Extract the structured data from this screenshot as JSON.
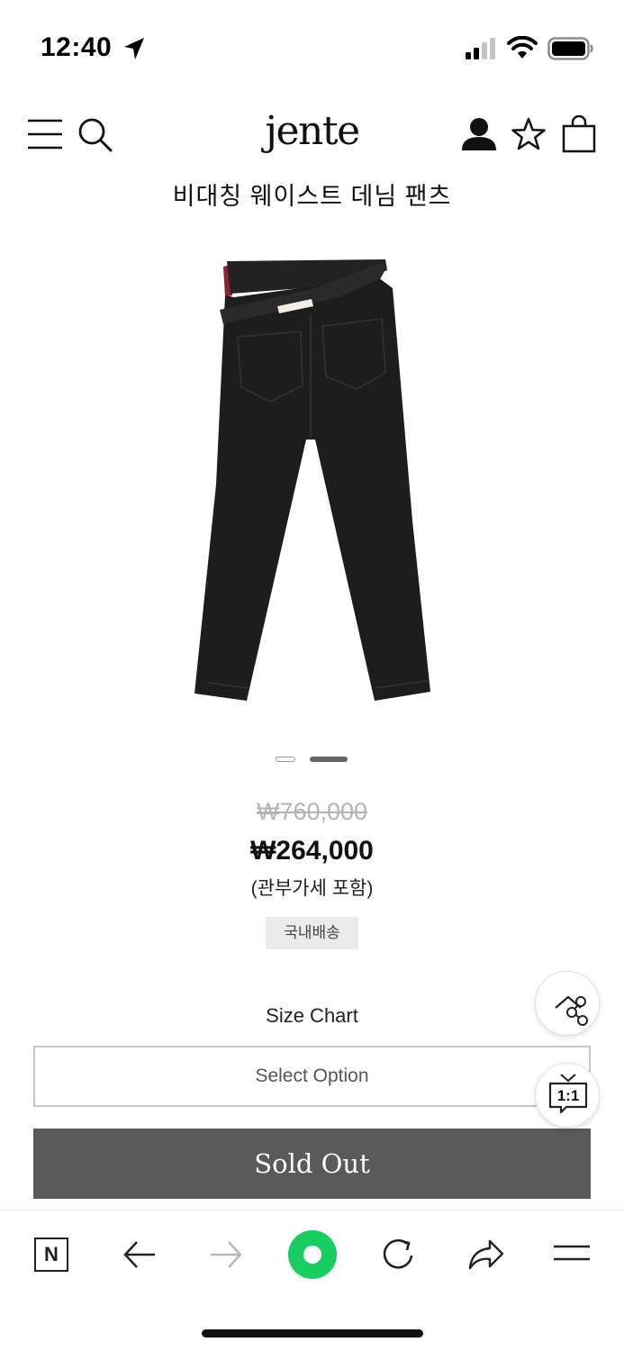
{
  "status_bar": {
    "time": "12:40"
  },
  "header": {
    "logo": "jente",
    "icons": [
      "menu-icon",
      "search-icon",
      "user-icon",
      "star-icon",
      "shopping-bag-icon"
    ]
  },
  "product": {
    "title": "비대칭 웨이스트 데님 팬츠",
    "image_count": 2,
    "active_image": 2,
    "price_original": "₩760,000",
    "price_sale": "₩264,000",
    "price_note": "(관부가세 포함)",
    "shipping_badge": "국내배송"
  },
  "options": {
    "size_chart_label": "Size Chart",
    "select_placeholder": "Select Option",
    "sold_out_label": "Sold Out"
  },
  "floating": {
    "share_icon": "share-icon",
    "chat_icon": "chat-1to1-icon",
    "chat_label": "1:1"
  },
  "browser_bar": {
    "icons": [
      "naver-home-icon",
      "back-arrow-icon",
      "forward-arrow-icon",
      "green-dot-icon",
      "reload-icon",
      "share-arrow-icon",
      "menu-lines-icon"
    ],
    "naver_label": "N"
  },
  "colors": {
    "sold_out_bg": "#5a5a5a",
    "green_accent": "#19ce60",
    "badge_bg": "#ebebeb"
  }
}
